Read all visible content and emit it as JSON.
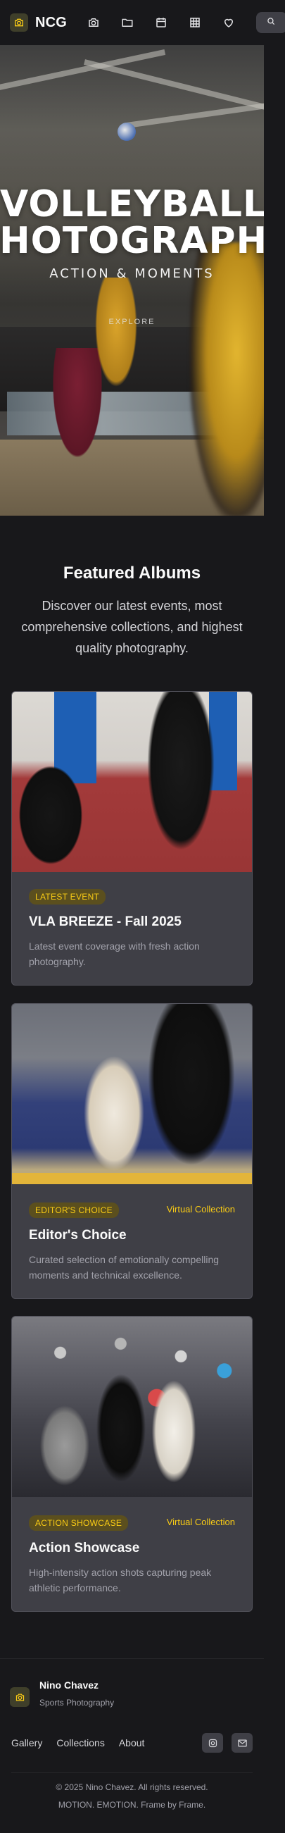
{
  "header": {
    "brand": "NCG",
    "nav_icons": [
      "camera-icon",
      "folder-icon",
      "calendar-icon",
      "grid-icon",
      "heart-icon"
    ],
    "search_icon": "search-icon",
    "accent_color": "#facc15"
  },
  "hero": {
    "title_line1": "VOLLEYBALL",
    "title_line2": "PHOTOGRAPHY",
    "subtitle": "ACTION & MOMENTS",
    "explore": "EXPLORE"
  },
  "featured": {
    "title": "Featured Albums",
    "description": "Discover our latest events, most comprehensive collections, and highest quality photography."
  },
  "cards": [
    {
      "badge": "LATEST EVENT",
      "virtual": "",
      "title": "VLA BREEZE - Fall 2025",
      "description": "Latest event coverage with fresh action photography."
    },
    {
      "badge": "EDITOR'S CHOICE",
      "virtual": "Virtual Collection",
      "title": "Editor's Choice",
      "description": "Curated selection of emotionally compelling moments and technical excellence."
    },
    {
      "badge": "ACTION SHOWCASE",
      "virtual": "Virtual Collection",
      "title": "Action Showcase",
      "description": "High-intensity action shots capturing peak athletic performance."
    }
  ],
  "footer": {
    "name": "Nino Chavez",
    "role": "Sports Photography",
    "links": [
      "Gallery",
      "Collections",
      "About"
    ],
    "social_icons": [
      "instagram-icon",
      "mail-icon"
    ],
    "copyright": "© 2025 Nino Chavez. All rights reserved.",
    "tagline": "MOTION. EMOTION. Frame by Frame."
  }
}
